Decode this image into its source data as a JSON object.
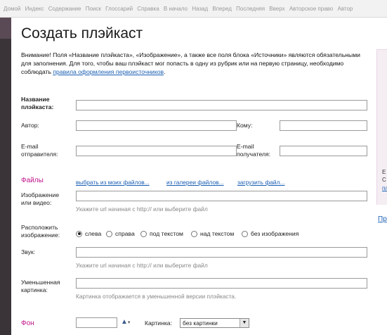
{
  "topnav": [
    "Домой",
    "Индекс",
    "Содержание",
    "Поиск",
    "Глоссарий",
    "Справка",
    "В начало",
    "Назад",
    "Вперед",
    "Последняя",
    "Вверх",
    "Авторское право",
    "Автор"
  ],
  "title": "Создать плэйкаст",
  "notice": {
    "text": "Внимание! Поля «Название плэйкаста», «Изображение», а также все поля блока «Источники» являются обязательными для заполнения. Для того, чтобы ваш плэйкаст мог попасть в одну из рубрик или на первую страницу, необходимо соблюдать ",
    "link": "правила оформления первоисточников",
    "end": "."
  },
  "form": {
    "name_label_1": "Название",
    "name_label_2": "плэйкаста:",
    "author_label": "Автор:",
    "to_label": "Кому:",
    "sender_email_1": "E-mail",
    "sender_email_2": "отправителя:",
    "recipient_email_1": "E-mail",
    "recipient_email_2": "получателя:"
  },
  "files": {
    "section": "Файлы",
    "link_my": "выбрать из моих файлов...",
    "link_gallery": "из галереи файлов...",
    "link_upload": "загрузить файл...",
    "image_label_1": "Изображение",
    "image_label_2": "или видео:",
    "image_hint": "Укажите url начиная с http:// или выберите файл",
    "place_label_1": "Расположить",
    "place_label_2": "изображение:",
    "radio_options": [
      "слева",
      "справа",
      "под текстом",
      "над текстом",
      "без изображения"
    ],
    "radio_selected": "слева",
    "sound_label": "Звук:",
    "sound_hint": "Укажите url начиная с http:// или выберите файл",
    "thumb_label_1": "Уменьшенная",
    "thumb_label_2": "картинка:",
    "thumb_hint": "Картинка отображается в уменьшенной версии плэйкаста."
  },
  "background": {
    "section": "Фон",
    "picture_label": "Картинка:",
    "picture_value": "без картинки"
  },
  "right_panel": {
    "text_1": "Е",
    "text_2": "С",
    "link_1": "пл",
    "link_2": "Пр"
  },
  "colors": {
    "accent": "#c0148a",
    "link": "#1a5fb4",
    "sidebar": "#3a3438"
  }
}
